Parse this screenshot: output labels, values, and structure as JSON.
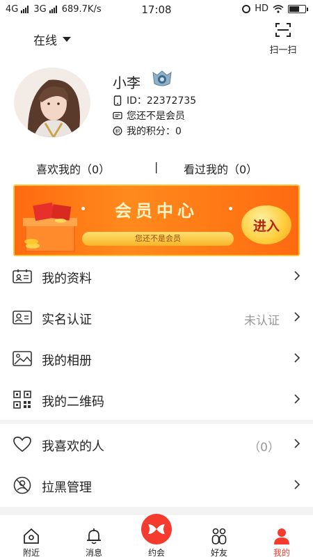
{
  "status_bar": {
    "network_1": "4G",
    "network_2": "3G",
    "speed": "689.7K/s",
    "time": "17:08",
    "hd": "HD"
  },
  "header": {
    "status_label": "在线",
    "scan_label": "扫一扫"
  },
  "profile": {
    "name": "小李",
    "id_text": "ID：22372735",
    "member_status": "您还不是会员",
    "points_text": "我的积分：0"
  },
  "likes": {
    "liked_me": "喜欢我的（0）",
    "separator": "|",
    "viewed_me": "看过我的（0）"
  },
  "banner": {
    "title": "会员中心",
    "subtitle": "您还不是会员",
    "enter_label": "进入"
  },
  "menu": {
    "items": [
      {
        "label": "我的资料",
        "value": ""
      },
      {
        "label": "实名认证",
        "value": "未认证"
      },
      {
        "label": "我的相册",
        "value": ""
      },
      {
        "label": "我的二维码",
        "value": ""
      },
      {
        "label": "我喜欢的人",
        "value": "（0）"
      },
      {
        "label": "拉黑管理",
        "value": ""
      }
    ]
  },
  "tabbar": {
    "items": [
      {
        "label": "附近"
      },
      {
        "label": "消息"
      },
      {
        "label": "约会"
      },
      {
        "label": "好友"
      },
      {
        "label": "我的"
      }
    ],
    "active_color": "#f53a2e"
  }
}
